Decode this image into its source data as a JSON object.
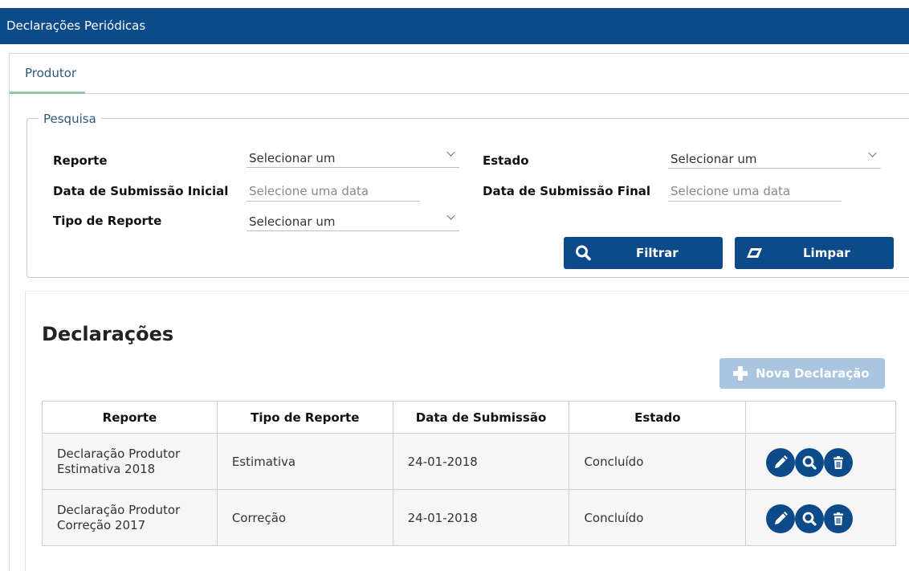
{
  "header": {
    "title": "Declarações Periódicas"
  },
  "tabs": [
    {
      "label": "Produtor",
      "active": true
    }
  ],
  "search": {
    "legend": "Pesquisa",
    "fields": {
      "reporte": {
        "label": "Reporte",
        "value": "Selecionar um"
      },
      "estado": {
        "label": "Estado",
        "value": "Selecionar um"
      },
      "data_inicial": {
        "label": "Data de Submissão Inicial",
        "placeholder": "Selecione uma data"
      },
      "data_final": {
        "label": "Data de Submissão Final",
        "placeholder": "Selecione uma data"
      },
      "tipo_reporte": {
        "label": "Tipo de Reporte",
        "value": "Selecionar um"
      }
    },
    "buttons": {
      "filter": "Filtrar",
      "clear": "Limpar"
    }
  },
  "declaracoes": {
    "title": "Declarações",
    "new_button": "Nova Declaração",
    "columns": [
      "Reporte",
      "Tipo de Reporte",
      "Data de Submissão",
      "Estado",
      ""
    ],
    "rows": [
      {
        "reporte_line1": "Declaração Produtor",
        "reporte_line2": "Estimativa 2018",
        "tipo": "Estimativa",
        "data": "24-01-2018",
        "estado": "Concluído"
      },
      {
        "reporte_line1": "Declaração Produtor",
        "reporte_line2": "Correção 2017",
        "tipo": "Correção",
        "data": "24-01-2018",
        "estado": "Concluído"
      }
    ],
    "row_actions": [
      "pencil-icon",
      "magnifier-icon",
      "trash-icon"
    ]
  },
  "colors": {
    "primary": "#0c4a8a",
    "disabled_button": "#a9c5e0",
    "tab_underline": "#8fc9a6"
  }
}
